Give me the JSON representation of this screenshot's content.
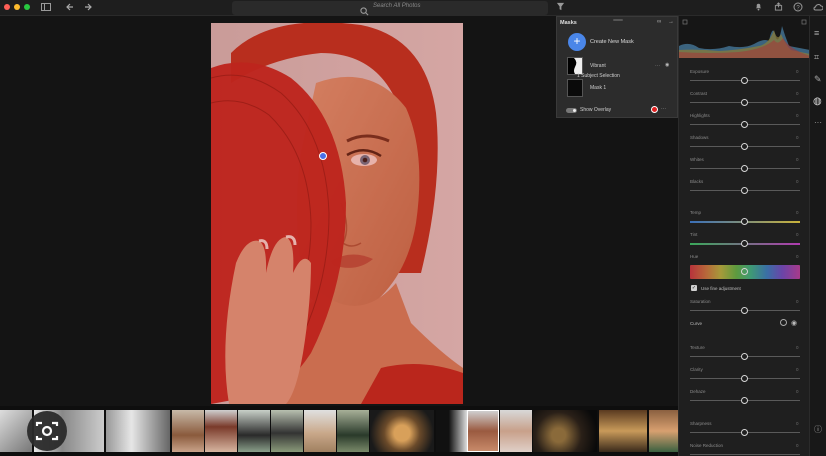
{
  "titlebar": {
    "search_placeholder": "Search All Photos",
    "traffic_lights": [
      "#ff5f57",
      "#febc2e",
      "#28c840"
    ]
  },
  "masks_panel": {
    "title": "Masks",
    "create_label": "Create New Mask",
    "mask_name": "Vibrant",
    "subject_label": "1 Subject Selection",
    "mask_item": "Mask 1",
    "show_overlay_label": "Show Overlay",
    "overlay_color": "#e02020"
  },
  "adjustments": {
    "exposure": {
      "label": "Exposure",
      "value": "0",
      "position": 0.5
    },
    "contrast": {
      "label": "Contrast",
      "value": "0",
      "position": 0.5
    },
    "highlights": {
      "label": "Highlights",
      "value": "0",
      "position": 0.5
    },
    "shadows": {
      "label": "Shadows",
      "value": "0",
      "position": 0.5
    },
    "whites": {
      "label": "Whites",
      "value": "0",
      "position": 0.5
    },
    "blacks": {
      "label": "Blacks",
      "value": "0",
      "position": 0.5
    },
    "temp": {
      "label": "Temp",
      "value": "0",
      "position": 0.5
    },
    "tint": {
      "label": "Tint",
      "value": "0",
      "position": 0.5
    },
    "hue": {
      "label": "Hue",
      "value": "0",
      "position": 0.5
    },
    "fine_adjustment_label": "Use fine adjustment",
    "saturation": {
      "label": "Saturation",
      "value": "0",
      "position": 0.5
    },
    "curve_label": "Curve",
    "texture": {
      "label": "Texture",
      "value": "0",
      "position": 0.5
    },
    "clarity": {
      "label": "Clarity",
      "value": "0",
      "position": 0.5
    },
    "dehaze": {
      "label": "Dehaze",
      "value": "0",
      "position": 0.5
    },
    "sharpness": {
      "label": "Sharpness",
      "value": "0",
      "position": 0.5
    },
    "noise_reduction": {
      "label": "Noise Reduction",
      "value": "0",
      "position": 0.5
    }
  },
  "colors": {
    "mask_overlay": "#c8201e",
    "accent": "#4a86e8"
  }
}
